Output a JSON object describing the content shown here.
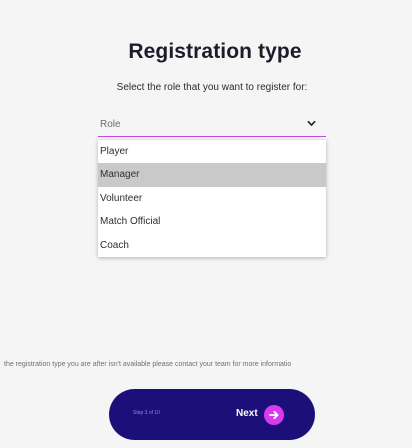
{
  "page": {
    "title": "Registration type",
    "subtitle": "Select the role that you want to register for:"
  },
  "role_select": {
    "label": "Role",
    "icon": "chevron-down-icon",
    "options": [
      "Player",
      "Manager",
      "Volunteer",
      "Match Official",
      "Coach"
    ],
    "highlighted_option": "Manager"
  },
  "notice": "the registration type you are after isn't available please contact your team for more informatio",
  "footer": {
    "step": "Step 3 of 10",
    "next_label": "Next",
    "next_icon": "arrow-right-icon"
  },
  "colors": {
    "accent": "#c54be6",
    "button_bg": "#1d0f7a",
    "arrow_circle": "#d93aef",
    "highlight": "#c9c9c9"
  }
}
